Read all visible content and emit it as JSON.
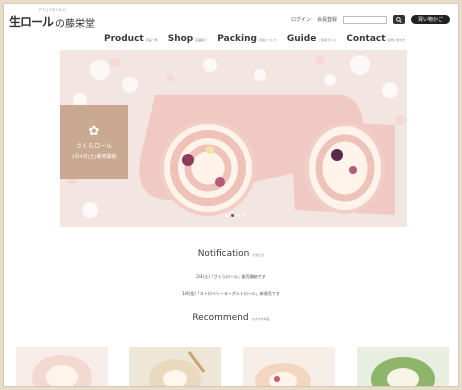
{
  "header": {
    "logo_mark": "生ロール",
    "logo_name": "の藤栄堂",
    "logo_sub": "FUJIEIDO",
    "login_label": "ログイン",
    "register_label": "会員登録",
    "search_placeholder": "",
    "cart_label": "買い物かご"
  },
  "nav": {
    "items": [
      {
        "label": "Product",
        "sub": "商品一覧"
      },
      {
        "label": "Shop",
        "sub": "店舗紹介"
      },
      {
        "label": "Packing",
        "sub": "包装について"
      },
      {
        "label": "Guide",
        "sub": "ご利用ガイド"
      },
      {
        "label": "Contact",
        "sub": "お問い合わせ"
      }
    ]
  },
  "hero": {
    "badge_title": "さくらロール",
    "badge_sub": "2月4日(土)販売開始",
    "slide_count": 4,
    "active_slide": 1
  },
  "notification": {
    "title": "Notification",
    "sub": "お知らせ",
    "items": [
      "2/4(土)「さくらロール」販売開始です",
      "1/6(金)「ストロベリーヨーグルトロール」新発売です"
    ]
  },
  "recommend": {
    "title": "Recommend",
    "sub": "おすすめ商品",
    "colors": [
      "#f2d9d2",
      "#e9d9bf",
      "#f3d6c0",
      "#8fb56a"
    ]
  },
  "colors": {
    "hero_bg": "#f3e6e2",
    "cake_pink": "#efc9c2",
    "badge_bg": "#c9a991"
  }
}
